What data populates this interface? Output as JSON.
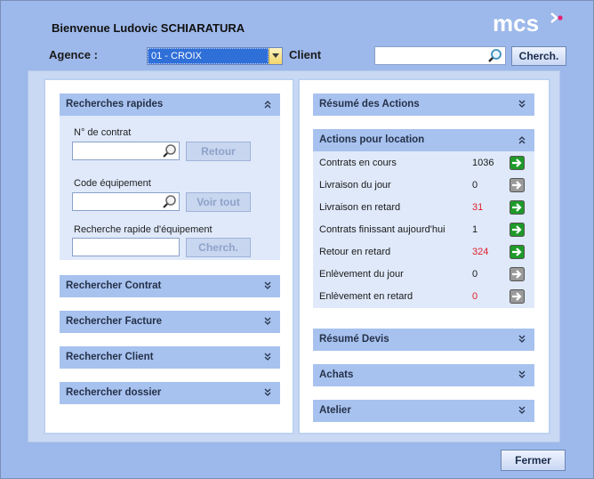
{
  "header": {
    "welcome": "Bienvenue Ludovic SCHIARATURA",
    "logo_text": "mcs",
    "agence_label": "Agence :",
    "agence_value": "01 - CROIX",
    "client_label": "Client",
    "client_value": "",
    "search_button": "Cherch."
  },
  "left": {
    "quick": {
      "title": "Recherches rapides",
      "contract_label": "N° de contrat",
      "contract_value": "",
      "retour_button": "Retour",
      "equip_label": "Code équipement",
      "equip_value": "",
      "voir_tout_button": "Voir tout",
      "rapid_label": "Recherche rapide d'équipement",
      "rapid_value": "",
      "cherch_button": "Cherch."
    },
    "sections": [
      {
        "title": "Rechercher Contrat"
      },
      {
        "title": "Rechercher Facture"
      },
      {
        "title": "Rechercher Client"
      },
      {
        "title": "Rechercher dossier"
      }
    ]
  },
  "right": {
    "summary_title": "Résumé des Actions",
    "location_title": "Actions pour location",
    "actions": [
      {
        "label": "Contrats en cours",
        "value": "1036",
        "red": false,
        "enabled": true
      },
      {
        "label": "Livraison du jour",
        "value": "0",
        "red": false,
        "enabled": false
      },
      {
        "label": "Livraison en retard",
        "value": "31",
        "red": true,
        "enabled": true
      },
      {
        "label": "Contrats finissant aujourd'hui",
        "value": "1",
        "red": false,
        "enabled": true
      },
      {
        "label": "Retour en retard",
        "value": "324",
        "red": true,
        "enabled": true
      },
      {
        "label": "Enlèvement du jour",
        "value": "0",
        "red": false,
        "enabled": false
      },
      {
        "label": "Enlèvement en retard",
        "value": "0",
        "red": true,
        "enabled": false
      }
    ],
    "sections": [
      {
        "title": "Résumé Devis"
      },
      {
        "title": "Achats"
      },
      {
        "title": "Atelier"
      }
    ]
  },
  "footer": {
    "close_button": "Fermer"
  },
  "colors": {
    "window_bg": "#9db8ea",
    "header_bg": "#a8c2ef",
    "body_bg": "#dfe9fa",
    "red_value": "#e0202a",
    "go_green": "#1f9a2a",
    "go_disabled": "#9a9a9a",
    "logo_accent": "#e6206f"
  },
  "icons": {
    "search": "magnifier-icon",
    "expand": "double-chevron-down-icon",
    "collapse": "double-chevron-up-icon",
    "go": "green-arrow-right-icon"
  }
}
